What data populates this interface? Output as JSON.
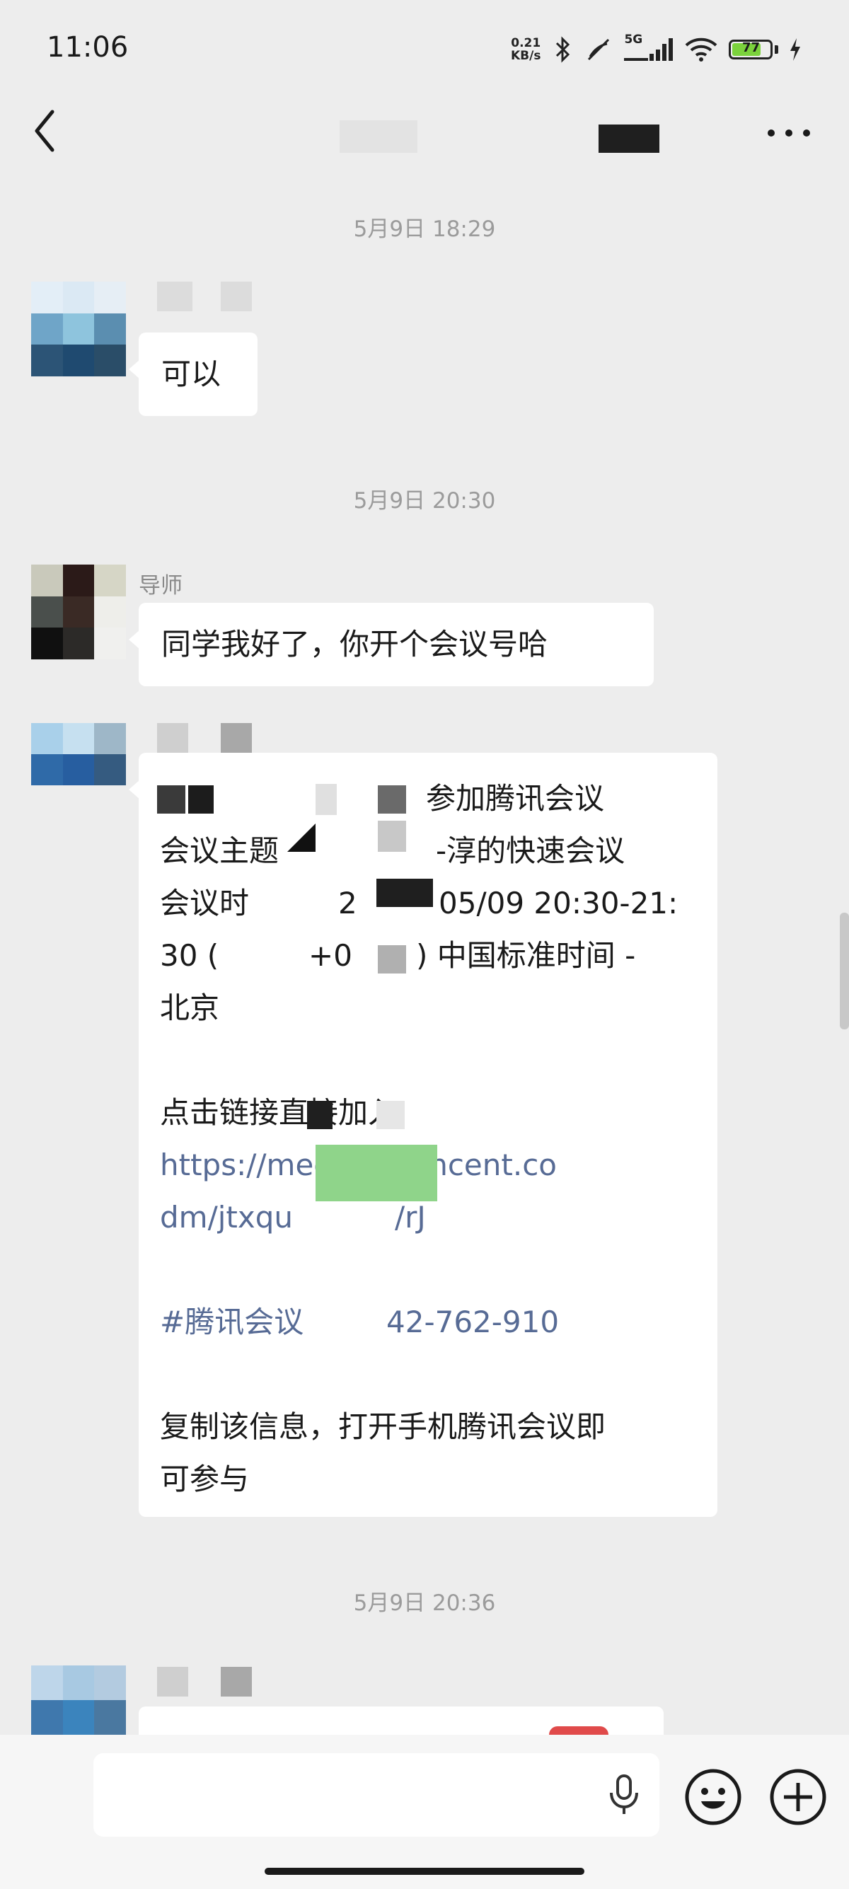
{
  "status_bar": {
    "time": "11:06",
    "net_speed_value": "0.21",
    "net_speed_unit": "KB/s",
    "signal_type": "5G",
    "battery_level": "77",
    "icons": [
      "bluetooth-icon",
      "no-sim-icon",
      "signal-icon",
      "wifi-icon",
      "battery-icon",
      "charging-icon"
    ]
  },
  "nav": {
    "back_icon": "chevron-left-icon",
    "more_icon": "more-icon"
  },
  "chat": {
    "timestamps": [
      "5月9日 18:29",
      "5月9日 20:30",
      "5月9日 20:36"
    ],
    "messages": [
      {
        "text": "可以"
      },
      {
        "sender": "导师",
        "text": "同学我好了，你开个会议号哈"
      },
      {
        "lines": [
          "参加腾讯会议",
          "会议主题",
          "-淳的快速会议",
          "会议时",
          "2",
          "05/09 20:30-21:",
          "30 (",
          "+0",
          ") 中国标准时间 -",
          "北京",
          "点击链接直接加入",
          "https://meeting.tencent.co",
          "dm/jtxqu",
          "/rJ",
          "#腾讯会议",
          "42-762-910",
          "复制该信息，打开手机腾讯会议即",
          "可参与"
        ]
      }
    ]
  },
  "input_bar": {
    "voice_icon": "microphone-icon",
    "emoji_icon": "emoji-icon",
    "plus_icon": "plus-icon"
  },
  "colors": {
    "background": "#ededed",
    "bubble": "#ffffff",
    "link": "#576b95",
    "timestamp": "#9b9b9b"
  }
}
